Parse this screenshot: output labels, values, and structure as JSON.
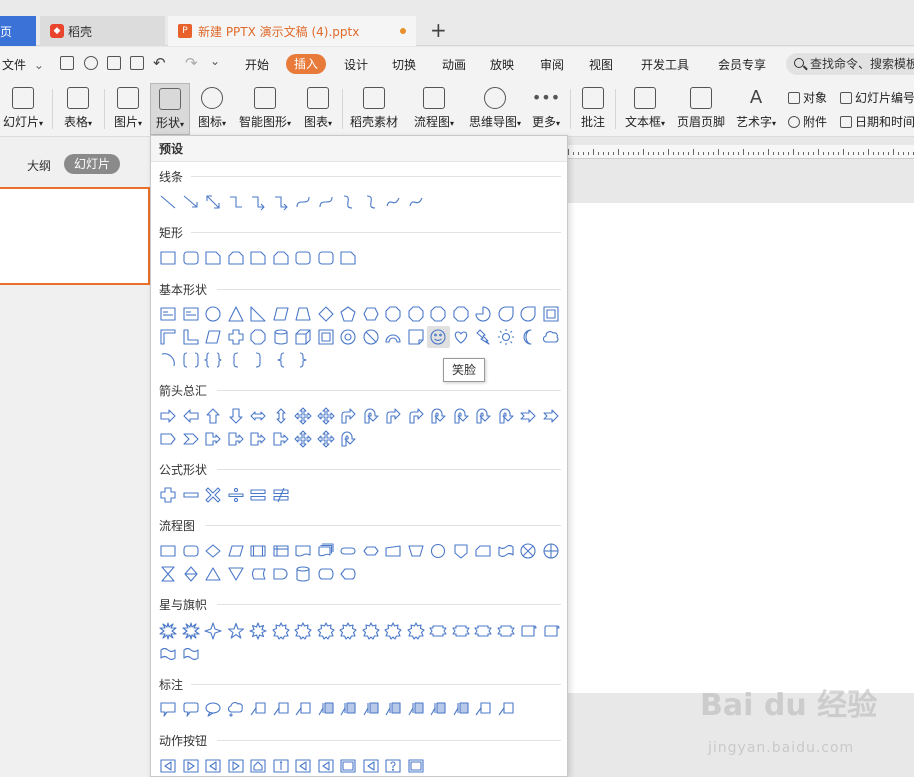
{
  "tabs": {
    "home": "页",
    "docer": "稻壳",
    "document": "新建 PPTX 演示文稿 (4).pptx",
    "add": "+"
  },
  "menu": {
    "file": "文件",
    "items": [
      "开始",
      "插入",
      "设计",
      "切换",
      "动画",
      "放映",
      "审阅",
      "视图",
      "开发工具",
      "会员专享"
    ],
    "active": "插入",
    "search_placeholder": "查找命令、搜索模板"
  },
  "ribbon": {
    "buttons": [
      "幻灯片",
      "表格",
      "图片",
      "形状",
      "图标",
      "智能图形",
      "图表",
      "稻壳素材",
      "流程图",
      "思维导图",
      "更多",
      "批注",
      "文本框",
      "页眉页脚",
      "艺术字"
    ],
    "active": "形状",
    "small": {
      "object": "对象",
      "slide_number": "幻灯片编号",
      "attachment": "附件",
      "datetime": "日期和时间"
    }
  },
  "left_panel": {
    "outline_tab": "大纲",
    "slides_tab": "幻灯片"
  },
  "shapes_panel": {
    "title": "预设",
    "sections": {
      "lines": "线条",
      "rectangles": "矩形",
      "basic": "基本形状",
      "arrows": "箭头总汇",
      "equation": "公式形状",
      "flowchart": "流程图",
      "stars": "星与旗帜",
      "callouts": "标注",
      "action_buttons": "动作按钮"
    },
    "tooltip": "笑脸"
  },
  "watermark": {
    "brand": "Bai du 经验",
    "site": "jingyan.baidu.com"
  },
  "colors": {
    "accent": "#e87a3a",
    "tab_blue": "#3a72d8",
    "shape_stroke": "#4a78c8"
  }
}
